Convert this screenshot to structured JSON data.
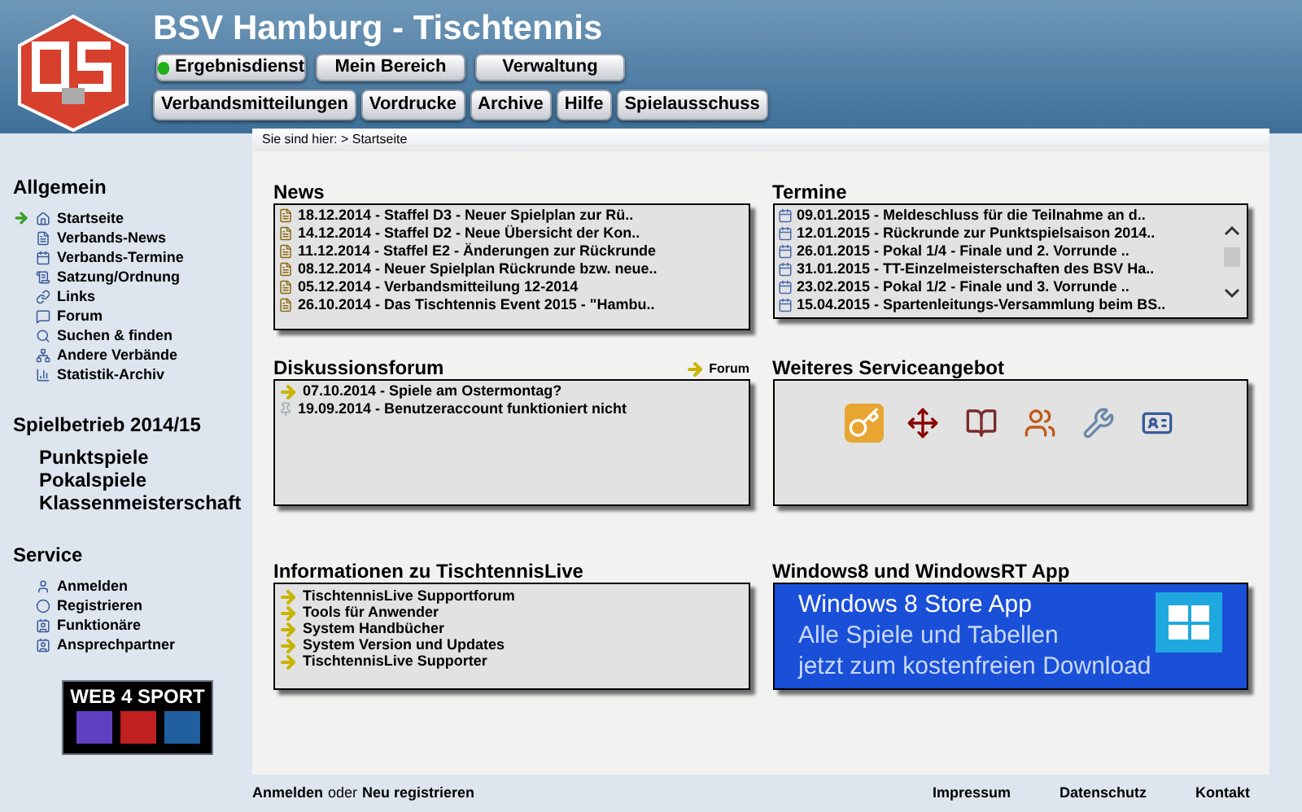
{
  "header": {
    "title": "BSV Hamburg - Tischtennis",
    "nav_top": [
      {
        "label": "Ergebnisdienst",
        "online": true
      },
      {
        "label": "Mein Bereich",
        "online": false
      },
      {
        "label": "Verwaltung",
        "online": false
      }
    ],
    "nav_bottom": [
      "Verbandsmitteilungen",
      "Vordrucke",
      "Archive",
      "Hilfe",
      "Spielausschuss"
    ]
  },
  "breadcrumb": "Sie sind hier: > Startseite",
  "sidebar": {
    "sections": [
      {
        "title": "Allgemein",
        "kind": "icons",
        "items": [
          {
            "label": "Startseite",
            "selected": true
          },
          {
            "label": "Verbands-News",
            "selected": false
          },
          {
            "label": "Verbands-Termine",
            "selected": false
          },
          {
            "label": "Satzung/Ordnung",
            "selected": false
          },
          {
            "label": "Links",
            "selected": false
          },
          {
            "label": "Forum",
            "selected": false
          },
          {
            "label": "Suchen & finden",
            "selected": false
          },
          {
            "label": "Andere Verbände",
            "selected": false
          },
          {
            "label": "Statistik-Archiv",
            "selected": false
          }
        ]
      },
      {
        "title": "Spielbetrieb 2014/15",
        "kind": "large",
        "items": [
          {
            "label": "Punktspiele",
            "selected": false
          },
          {
            "label": "Pokalspiele",
            "selected": false
          },
          {
            "label": "Klassenmeisterschaft",
            "selected": false
          }
        ]
      },
      {
        "title": "Service",
        "kind": "icons",
        "items": [
          {
            "label": "Anmelden",
            "selected": false
          },
          {
            "label": "Registrieren",
            "selected": false
          },
          {
            "label": "Funktionäre",
            "selected": false
          },
          {
            "label": "Ansprechpartner",
            "selected": false
          }
        ]
      }
    ],
    "banner": "WEB 4 SPORT"
  },
  "news": {
    "title": "News",
    "items": [
      "18.12.2014 - Staffel D3 - Neuer Spielplan zur Rü..",
      "14.12.2014 - Staffel D2 - Neue Übersicht der Kon..",
      "11.12.2014 - Staffel E2 - Änderungen zur Rückrunde",
      "08.12.2014 - Neuer Spielplan Rückrunde bzw. neue..",
      "05.12.2014 - Verbandsmitteilung 12-2014",
      "26.10.2014 - Das Tischtennis Event 2015 - \"Hambu.."
    ]
  },
  "termine": {
    "title": "Termine",
    "items": [
      "09.01.2015 - Meldeschluss für die Teilnahme an d..",
      "12.01.2015 - Rückrunde zur Punktspielsaison 2014..",
      "26.01.2015 - Pokal 1/4 - Finale und 2. Vorrunde ..",
      "31.01.2015 - TT-Einzelmeisterschaften des BSV Ha..",
      "23.02.2015 - Pokal 1/2 - Finale und 3. Vorrunde ..",
      "15.04.2015 - Spartenleitungs-Versammlung beim BS.."
    ]
  },
  "forum": {
    "title": "Diskussionsforum",
    "link": "Forum",
    "items": [
      {
        "label": "07.10.2014 - Spiele am Ostermontag?",
        "kind": "arrow"
      },
      {
        "label": "19.09.2014 - Benutzeraccount funktioniert nicht",
        "kind": "pin"
      }
    ]
  },
  "service": {
    "title": "Weiteres Serviceangebot"
  },
  "tt_live": {
    "title": "Informationen zu TischtennisLive",
    "items": [
      "TischtennisLive Supportforum",
      "Tools für Anwender",
      "System Handbücher",
      "System Version und Updates",
      "TischtennisLive Supporter"
    ]
  },
  "app": {
    "title": "Windows8 und WindowsRT App",
    "lines": [
      "Windows 8 Store App",
      "Alle Spiele und Tabellen",
      "jetzt zum kostenfreien Download"
    ]
  },
  "footer": {
    "login": "Anmelden",
    "or": "oder",
    "register": "Neu registrieren",
    "links": [
      "Impressum",
      "Datenschutz",
      "Kontakt"
    ]
  }
}
